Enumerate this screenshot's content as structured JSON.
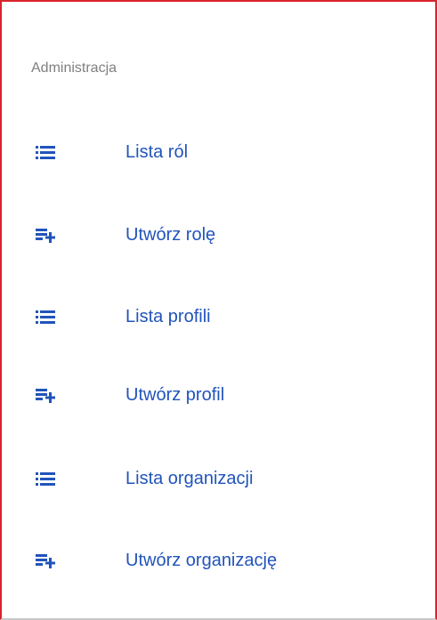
{
  "colors": {
    "accent": "#2154bb",
    "header_text": "#7f7f7f",
    "frame_border": "#d8232a",
    "background": "#ffffff"
  },
  "menu": {
    "section_header": "Administracja",
    "items": [
      {
        "label": "Lista ról",
        "icon": "list-icon"
      },
      {
        "label": "Utwórz rolę",
        "icon": "playlist-add-icon"
      },
      {
        "label": "Lista profili",
        "icon": "list-icon"
      },
      {
        "label": "Utwórz profil",
        "icon": "playlist-add-icon"
      },
      {
        "label": "Lista organizacji",
        "icon": "list-icon"
      },
      {
        "label": "Utwórz organizację",
        "icon": "playlist-add-icon"
      }
    ]
  }
}
